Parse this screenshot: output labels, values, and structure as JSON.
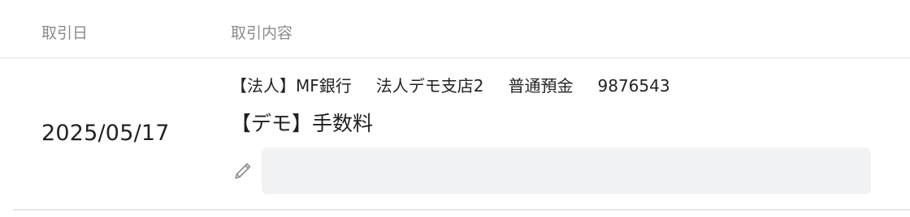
{
  "table": {
    "headers": {
      "date": "取引日",
      "description": "取引内容"
    },
    "rows": [
      {
        "date": "2025/05/17",
        "account": {
          "bank": "【法人】MF銀行",
          "branch": "法人デモ支店2",
          "type": "普通預金",
          "number": "9876543"
        },
        "description": "【デモ】手数料",
        "memo": {
          "value": "",
          "placeholder": ""
        },
        "edit_icon": "pencil-icon"
      }
    ]
  },
  "colors": {
    "header_text": "#8a8a8a",
    "memo_background": "#f1f2f4",
    "divider": "#e2e2e2"
  }
}
